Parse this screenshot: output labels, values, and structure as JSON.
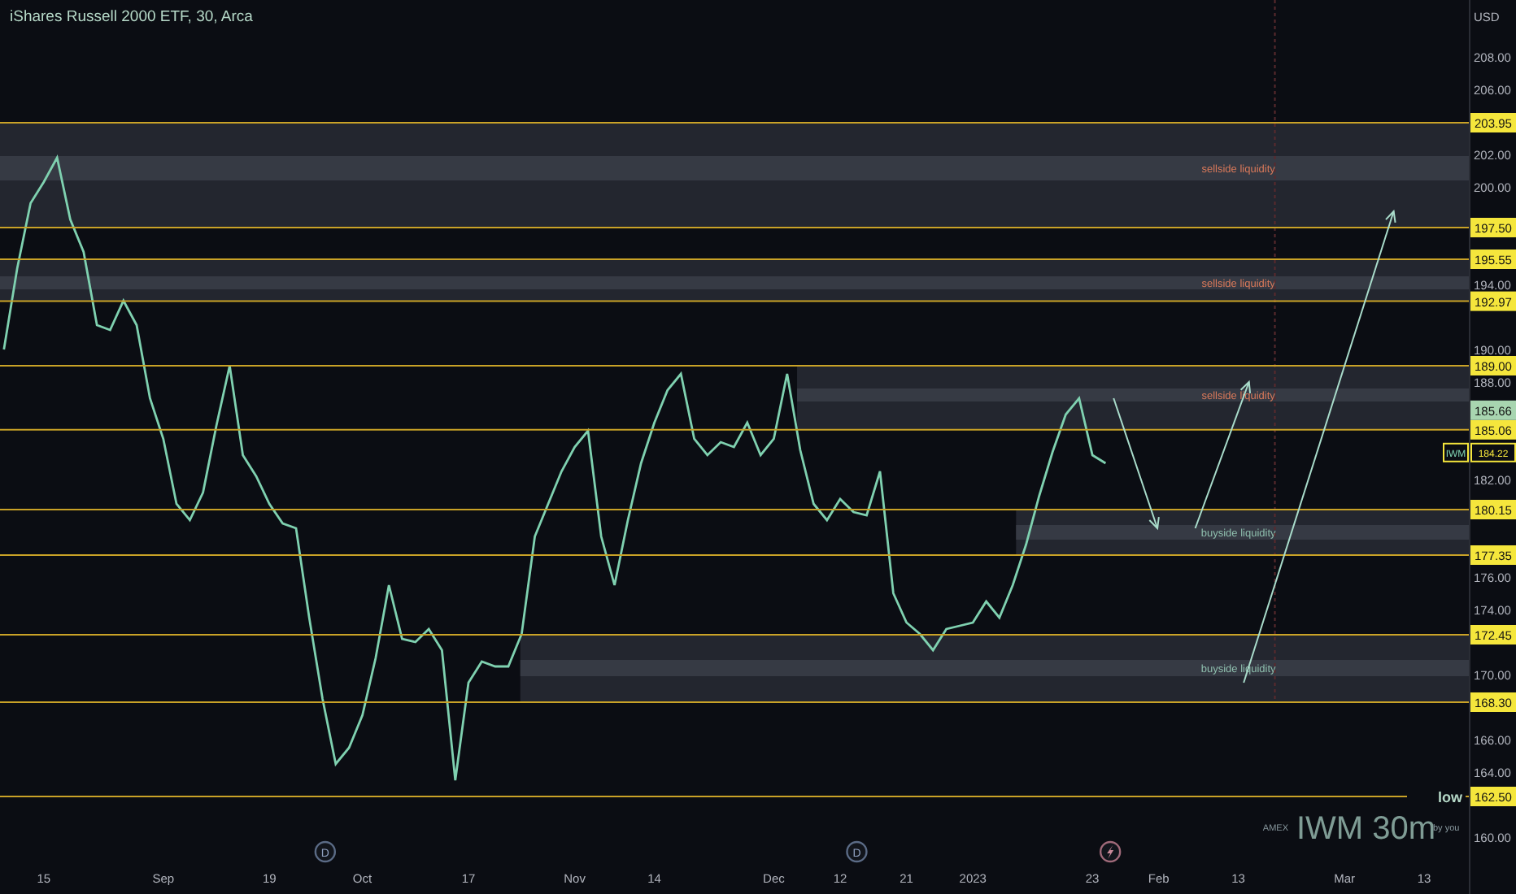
{
  "chart": {
    "title": "iShares Russell 2000 ETF, 30, Arca",
    "currency": "USD",
    "last_price": "185.66",
    "symbol_price": "184.22",
    "chart_data": {
      "type": "line",
      "ylim": [
        156.5,
        211.5
      ],
      "categories": [
        null,
        null,
        null,
        "15",
        null,
        null,
        null,
        null,
        null,
        null,
        null,
        null,
        "Sep",
        null,
        null,
        null,
        null,
        null,
        null,
        null,
        "19",
        null,
        null,
        null,
        null,
        null,
        null,
        "Oct",
        null,
        null,
        null,
        null,
        null,
        null,
        null,
        "17",
        null,
        null,
        null,
        null,
        null,
        null,
        null,
        "Nov",
        null,
        null,
        null,
        null,
        null,
        "14",
        null,
        null,
        null,
        null,
        null,
        null,
        null,
        null,
        "Dec",
        null,
        null,
        null,
        null,
        "12",
        null,
        null,
        null,
        null,
        "21",
        null,
        null,
        null,
        null,
        "2023",
        null,
        null,
        null,
        null,
        null,
        null,
        null,
        null,
        "23",
        null,
        null,
        null,
        null,
        "Feb",
        null,
        null,
        null,
        null,
        null,
        "13",
        null,
        null,
        null,
        null,
        null,
        null,
        null,
        "Mar",
        null,
        null,
        null,
        null,
        null,
        "13",
        null
      ],
      "yticks": [
        {
          "value": 208,
          "label": "208.00"
        },
        {
          "value": 206,
          "label": "206.00"
        },
        {
          "value": 202,
          "label": "202.00"
        },
        {
          "value": 200,
          "label": "200.00"
        },
        {
          "value": 194,
          "label": "194.00"
        },
        {
          "value": 190,
          "label": "190.00"
        },
        {
          "value": 188,
          "label": "188.00"
        },
        {
          "value": 182,
          "label": "182.00"
        },
        {
          "value": 176,
          "label": "176.00"
        },
        {
          "value": 174,
          "label": "174.00"
        },
        {
          "value": 170,
          "label": "170.00"
        },
        {
          "value": 166,
          "label": "166.00"
        },
        {
          "value": 164,
          "label": "164.00"
        },
        {
          "value": 160,
          "label": "160.00"
        }
      ],
      "series": [
        {
          "name": "IWM",
          "color": "#7fd1b0",
          "values": [
            190,
            195,
            199,
            200.3,
            201.8,
            198,
            196,
            191.5,
            191.2,
            193,
            191.5,
            187,
            184.5,
            180.5,
            179.5,
            181.2,
            185.3,
            189,
            183.5,
            182.2,
            180.5,
            179.3,
            179,
            173.5,
            168.5,
            164.5,
            165.5,
            167.5,
            171,
            175.5,
            172.2,
            172,
            172.8,
            171.5,
            163.5,
            169.5,
            170.8,
            170.5,
            170.5,
            172.5,
            178.5,
            180.5,
            182.5,
            184,
            185,
            178.5,
            175.5,
            179.5,
            183,
            185.5,
            187.5,
            188.5,
            184.5,
            183.5,
            184.3,
            184,
            185.5,
            183.5,
            184.5,
            188.5,
            183.8,
            180.5,
            179.5,
            180.8,
            180,
            179.8,
            182.5,
            175,
            173.2,
            172.5,
            171.5,
            172.8,
            173,
            173.2,
            174.5,
            173.5,
            175.5,
            178,
            181,
            183.7,
            186,
            187,
            183.5,
            183,
            null,
            null,
            null,
            null,
            null,
            null,
            null,
            null,
            null,
            null,
            null,
            null,
            null,
            null,
            null,
            null,
            null,
            null,
            null,
            null,
            null,
            null,
            null,
            null,
            null
          ]
        }
      ],
      "bands": [
        {
          "axis": "y",
          "from": 197.5,
          "to": 203.95,
          "color": "#23262f"
        },
        {
          "axis": "y",
          "from": 192.97,
          "to": 195.55,
          "color": "#23262f"
        },
        {
          "axis": "y",
          "from": 185.06,
          "to": 189,
          "color": "#23262f"
        },
        {
          "axis": "y",
          "from": 177.35,
          "to": 180.15,
          "color": "#23262f"
        },
        {
          "axis": "y",
          "from": 168.3,
          "to": 172.45,
          "color": "#23262f"
        },
        {
          "axis": "y",
          "from": 200.4,
          "to": 201.9,
          "color": "#363a44",
          "label": "sellside liquidity"
        },
        {
          "axis": "y",
          "from": 193.7,
          "to": 194.5,
          "color": "#363a44",
          "label": "sellside liquidity"
        },
        {
          "axis": "y",
          "from": 186.8,
          "to": 187.6,
          "color": "#363a44",
          "label": "sellside liquidity"
        },
        {
          "axis": "y",
          "from": 178.3,
          "to": 179.2,
          "color": "#363a44",
          "label": "buyside liquidity"
        },
        {
          "axis": "y",
          "from": 169.9,
          "to": 170.9,
          "color": "#363a44",
          "label": "buyside liquidity"
        }
      ],
      "ref_lines": [
        {
          "axis": "y",
          "value": 203.95,
          "label": "203.95"
        },
        {
          "axis": "y",
          "value": 197.5,
          "label": "197.50"
        },
        {
          "axis": "y",
          "value": 195.55,
          "label": "195.55"
        },
        {
          "axis": "y",
          "value": 192.97,
          "label": "192.97"
        },
        {
          "axis": "y",
          "value": 189,
          "label": "189.00"
        },
        {
          "axis": "y",
          "value": 185.06,
          "label": "185.06"
        },
        {
          "axis": "y",
          "value": 180.15,
          "label": "180.15"
        },
        {
          "axis": "y",
          "value": 177.35,
          "label": "177.35"
        },
        {
          "axis": "y",
          "value": 172.45,
          "label": "172.45"
        },
        {
          "axis": "y",
          "value": 168.3,
          "label": "168.30"
        },
        {
          "axis": "y",
          "value": 162.5,
          "label": "162.50"
        }
      ],
      "annotations": [
        "low"
      ]
    },
    "events": [
      {
        "kind": "dividend",
        "label": "D"
      },
      {
        "kind": "dividend",
        "label": "D"
      },
      {
        "kind": "earnings"
      }
    ]
  },
  "watermark": {
    "exchange": "AMEX",
    "symbol": "IWM 30m",
    "author": "by you"
  }
}
